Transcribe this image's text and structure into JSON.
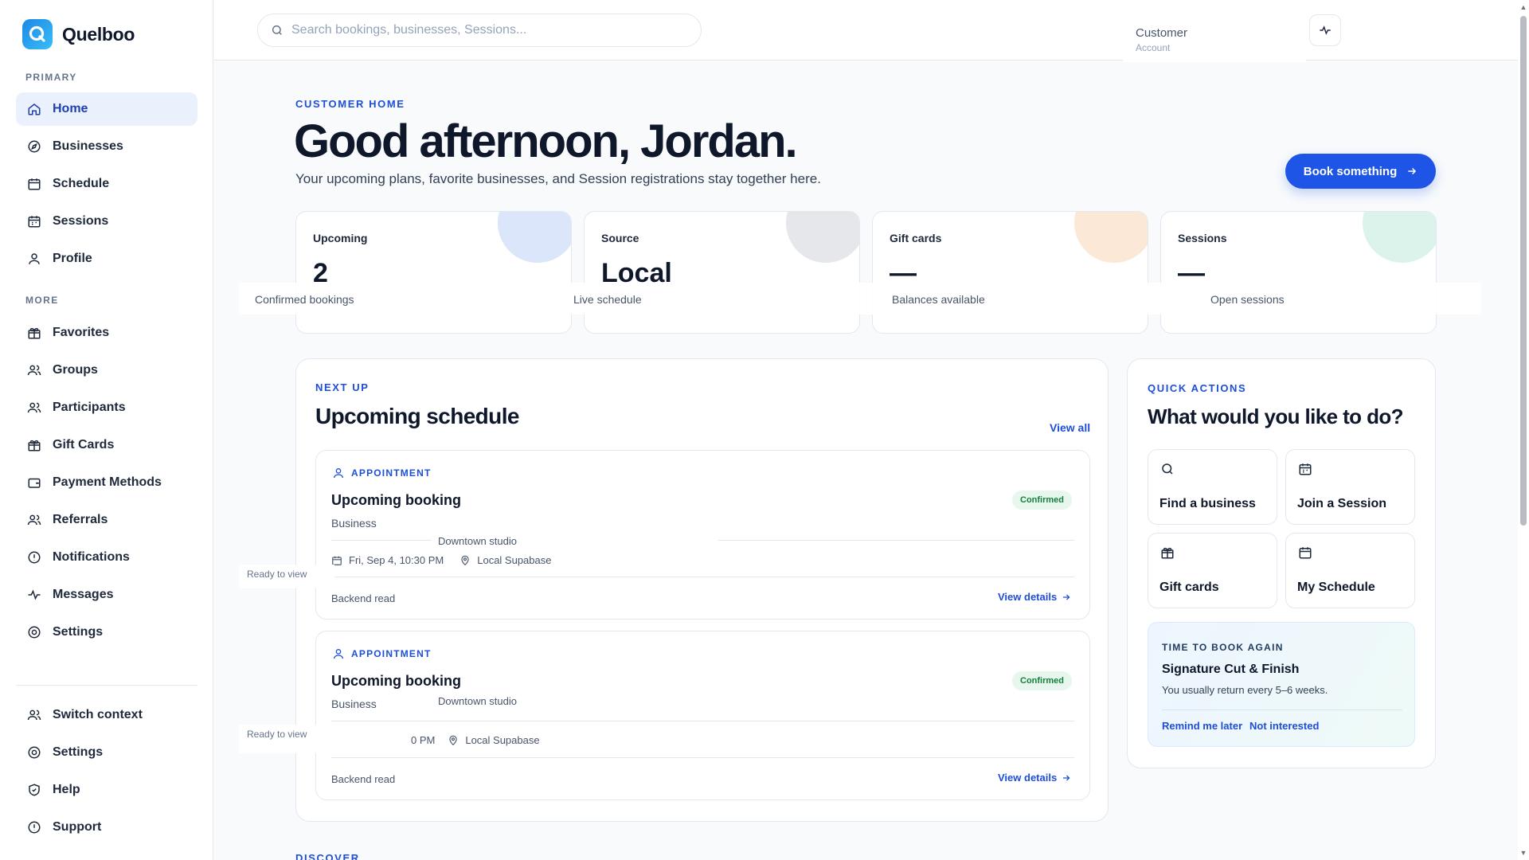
{
  "app": {
    "name": "Quelboo"
  },
  "colors": {
    "accent": "#1e55e6",
    "success": "#15803d",
    "brand_gradient_start": "#1e88e5",
    "brand_gradient_end": "#38bdf8"
  },
  "sidebar": {
    "primary_label": "PRIMARY",
    "primary": [
      {
        "label": "Home",
        "icon": "home-icon",
        "active": true
      },
      {
        "label": "Businesses",
        "icon": "compass-icon"
      },
      {
        "label": "Schedule",
        "icon": "calendar-icon"
      },
      {
        "label": "Sessions",
        "icon": "calendar-grid-icon"
      },
      {
        "label": "Profile",
        "icon": "user-icon"
      }
    ],
    "more_label": "MORE",
    "more": [
      {
        "label": "Favorites",
        "icon": "gift-icon"
      },
      {
        "label": "Groups",
        "icon": "users-icon"
      },
      {
        "label": "Participants",
        "icon": "users-icon"
      },
      {
        "label": "Gift Cards",
        "icon": "gift-icon"
      },
      {
        "label": "Payment Methods",
        "icon": "wallet-icon"
      },
      {
        "label": "Referrals",
        "icon": "users-icon"
      },
      {
        "label": "Notifications",
        "icon": "alert-circle-icon"
      },
      {
        "label": "Messages",
        "icon": "activity-icon"
      },
      {
        "label": "Settings",
        "icon": "settings-icon"
      }
    ],
    "footer": [
      {
        "label": "Switch context",
        "icon": "users-icon"
      },
      {
        "label": "Settings",
        "icon": "settings-icon"
      },
      {
        "label": "Help",
        "icon": "shield-icon"
      },
      {
        "label": "Support",
        "icon": "alert-circle-icon"
      }
    ]
  },
  "topbar": {
    "search_placeholder": "Search bookings, businesses, Sessions...",
    "account_title": "Customer",
    "account_sub": "Account"
  },
  "hero": {
    "eyebrow": "CUSTOMER HOME",
    "title": "Good afternoon, Jordan.",
    "subtitle": "Your upcoming plans, favorite businesses, and Session registrations stay together here.",
    "cta": "Book something"
  },
  "stats": [
    {
      "label": "Upcoming",
      "value": "2",
      "note": "Confirmed bookings",
      "blob": "#dbe6fb"
    },
    {
      "label": "Source",
      "value": "Local",
      "note": "Live schedule",
      "blob": "#e5e7eb"
    },
    {
      "label": "Gift cards",
      "value": "—",
      "note": "Balances available",
      "blob": "#fbe8d6"
    },
    {
      "label": "Sessions",
      "value": "—",
      "note": "Open sessions",
      "blob": "#dcf3ec"
    }
  ],
  "schedule": {
    "eyebrow": "NEXT UP",
    "title": "Upcoming schedule",
    "view_all": "View all",
    "bookings": [
      {
        "kind": "APPOINTMENT",
        "title": "Upcoming booking",
        "subtitle": "Business",
        "status": "Confirmed",
        "location": "Downtown studio",
        "date": "Fri, Sep 4, 10:30 PM",
        "source": "Local Supabase",
        "ready": "Ready to view",
        "footer": "Backend read",
        "details": "View details"
      },
      {
        "kind": "APPOINTMENT",
        "title": "Upcoming booking",
        "subtitle": "Business",
        "status": "Confirmed",
        "location": "Downtown studio",
        "date": "0 PM",
        "source": "Local Supabase",
        "ready": "Ready to view",
        "footer": "Backend read",
        "details": "View details"
      }
    ]
  },
  "quick_actions": {
    "eyebrow": "QUICK ACTIONS",
    "title": "What would you like to do?",
    "items": [
      {
        "label": "Find a business",
        "icon": "search-icon"
      },
      {
        "label": "Join a Session",
        "icon": "calendar-grid-icon"
      },
      {
        "label": "Gift cards",
        "icon": "gift-icon"
      },
      {
        "label": "My Schedule",
        "icon": "calendar-icon"
      }
    ],
    "rebook": {
      "eyebrow": "TIME TO BOOK AGAIN",
      "title": "Signature Cut & Finish",
      "subtitle": "You usually return every 5–6 weeks.",
      "remind": "Remind me later",
      "dismiss": "Not interested"
    }
  },
  "discover": "DISCOVER"
}
